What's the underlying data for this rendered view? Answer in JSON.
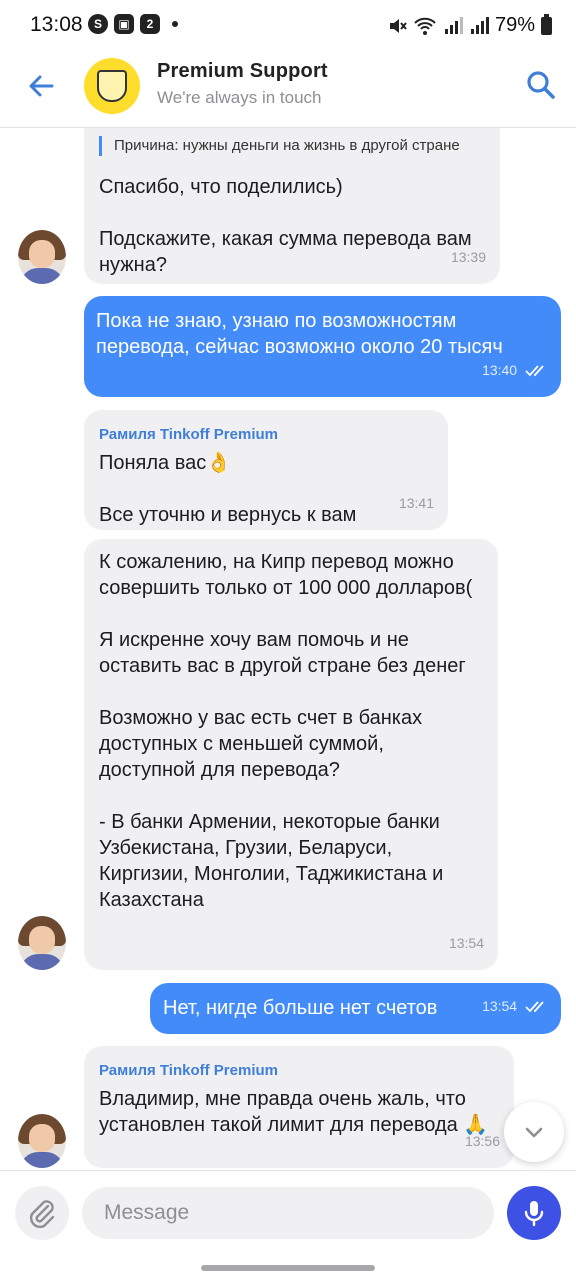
{
  "status_bar": {
    "time": "13:08",
    "battery": "79%"
  },
  "header": {
    "title": "Premium Support",
    "subtitle": "We're always in touch"
  },
  "messages": [
    {
      "id": "m1",
      "direction": "incoming",
      "quote": "Причина: нужны деньги на жизнь в другой стране",
      "text": "Спасибо, что поделились)\n\nПодскажите, какая сумма перевода вам нужна?",
      "time": "13:39"
    },
    {
      "id": "m2",
      "direction": "outgoing",
      "text": "Пока не знаю, узнаю по возможностям перевода, сейчас возможно около 20 тысяч",
      "time": "13:40"
    },
    {
      "id": "m3",
      "direction": "incoming",
      "sender": "Рамиля Tinkoff Premium",
      "text": "Поняла вас👌\n\nВсе уточню и вернусь к вам",
      "time": "13:41"
    },
    {
      "id": "m4",
      "direction": "incoming",
      "text": "К сожалению, на Кипр перевод можно совершить только от 100 000 долларов(\n\nЯ искренне хочу вам помочь и не оставить вас в другой стране без денег\n\nВозможно у вас есть счет в банках доступных с меньшей суммой, доступной для перевода?\n\n- В банки Армении, некоторые банки Узбекистана, Грузии, Беларуси, Киргизии, Монголии, Таджикистана и Казахстана",
      "time": "13:54"
    },
    {
      "id": "m5",
      "direction": "outgoing",
      "text": "Нет, нигде больше нет счетов",
      "time": "13:54"
    },
    {
      "id": "m6",
      "direction": "incoming",
      "sender": "Рамиля Tinkoff Premium",
      "text": "Владимир, мне правда очень жаль, что установлен такой лимит для перевода 🙏",
      "time": "13:56"
    }
  ],
  "composer": {
    "placeholder": "Message"
  },
  "colors": {
    "accent": "#428bf9",
    "mic": "#3d51e4",
    "incoming_bubble": "#f0f0f3",
    "brand_yellow": "#ffdd2d"
  },
  "icons": {
    "back": "arrow-left-icon",
    "search": "search-icon",
    "attach": "paperclip-icon",
    "mic": "microphone-icon",
    "scroll": "chevron-down-icon",
    "read": "double-check-icon"
  }
}
